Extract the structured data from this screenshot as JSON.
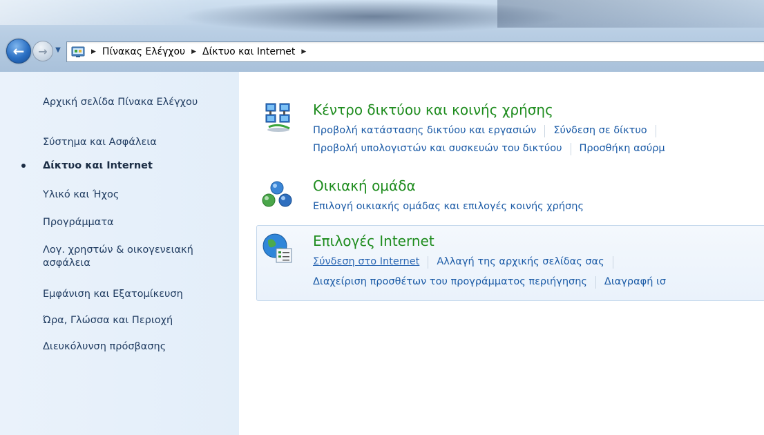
{
  "breadcrumb": {
    "items": [
      "Πίνακας Ελέγχου",
      "Δίκτυο και Internet"
    ]
  },
  "sidebar": {
    "items": [
      {
        "label": "Αρχική σελίδα Πίνακα Ελέγχου"
      },
      {
        "label": "Σύστημα και Ασφάλεια"
      },
      {
        "label": "Δίκτυο και Internet",
        "current": true
      },
      {
        "label": "Υλικό και Ήχος"
      },
      {
        "label": "Προγράμματα"
      },
      {
        "label_line1": "Λογ. χρηστών & οικογενειακή",
        "label_line2": "ασφάλεια"
      },
      {
        "label": "Εμφάνιση και Εξατομίκευση"
      },
      {
        "label": "Ώρα, Γλώσσα και Περιοχή"
      },
      {
        "label": "Διευκόλυνση πρόσβασης"
      }
    ]
  },
  "categories": [
    {
      "title": "Κέντρο δικτύου και κοινής χρήσης",
      "icon": "network-center-icon",
      "tasks_row1": [
        "Προβολή κατάστασης δικτύου και εργασιών",
        "Σύνδεση σε δίκτυο"
      ],
      "tasks_row2": [
        "Προβολή υπολογιστών και συσκευών του δικτύου",
        "Προσθήκη ασύρμ"
      ]
    },
    {
      "title": "Οικιακή ομάδα",
      "icon": "homegroup-icon",
      "tasks_row1": [
        "Επιλογή οικιακής ομάδας και επιλογές κοινής χρήσης"
      ]
    },
    {
      "title": "Επιλογές Internet",
      "icon": "internet-options-icon",
      "tasks_row1": [
        "Σύνδεση στο Internet",
        "Αλλαγή της αρχικής σελίδας σας"
      ],
      "tasks_row2": [
        "Διαχείριση προσθέτων του προγράμματος περιήγησης",
        "Διαγραφή ισ"
      ]
    }
  ],
  "colors": {
    "title_green": "#1e8c1e",
    "link_blue": "#1a5aa6",
    "sidebar_bg": "#e3eef9"
  }
}
